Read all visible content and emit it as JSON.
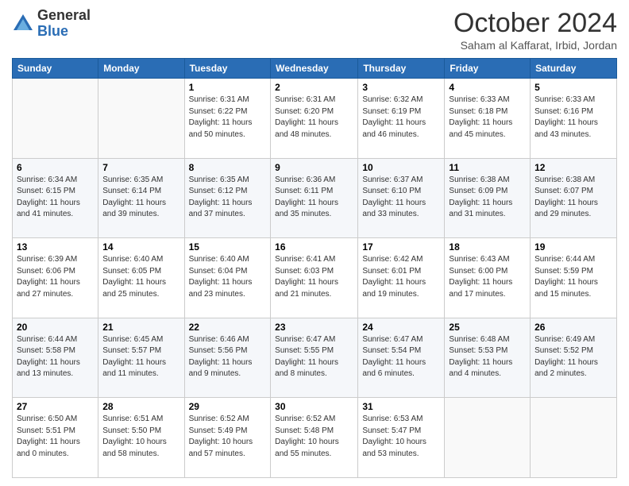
{
  "header": {
    "logo": {
      "general": "General",
      "blue": "Blue"
    },
    "title": "October 2024",
    "subtitle": "Saham al Kaffarat, Irbid, Jordan"
  },
  "calendar": {
    "days_of_week": [
      "Sunday",
      "Monday",
      "Tuesday",
      "Wednesday",
      "Thursday",
      "Friday",
      "Saturday"
    ],
    "weeks": [
      [
        {
          "day": "",
          "sunrise": "",
          "sunset": "",
          "daylight": ""
        },
        {
          "day": "",
          "sunrise": "",
          "sunset": "",
          "daylight": ""
        },
        {
          "day": "1",
          "sunrise": "Sunrise: 6:31 AM",
          "sunset": "Sunset: 6:22 PM",
          "daylight": "Daylight: 11 hours and 50 minutes."
        },
        {
          "day": "2",
          "sunrise": "Sunrise: 6:31 AM",
          "sunset": "Sunset: 6:20 PM",
          "daylight": "Daylight: 11 hours and 48 minutes."
        },
        {
          "day": "3",
          "sunrise": "Sunrise: 6:32 AM",
          "sunset": "Sunset: 6:19 PM",
          "daylight": "Daylight: 11 hours and 46 minutes."
        },
        {
          "day": "4",
          "sunrise": "Sunrise: 6:33 AM",
          "sunset": "Sunset: 6:18 PM",
          "daylight": "Daylight: 11 hours and 45 minutes."
        },
        {
          "day": "5",
          "sunrise": "Sunrise: 6:33 AM",
          "sunset": "Sunset: 6:16 PM",
          "daylight": "Daylight: 11 hours and 43 minutes."
        }
      ],
      [
        {
          "day": "6",
          "sunrise": "Sunrise: 6:34 AM",
          "sunset": "Sunset: 6:15 PM",
          "daylight": "Daylight: 11 hours and 41 minutes."
        },
        {
          "day": "7",
          "sunrise": "Sunrise: 6:35 AM",
          "sunset": "Sunset: 6:14 PM",
          "daylight": "Daylight: 11 hours and 39 minutes."
        },
        {
          "day": "8",
          "sunrise": "Sunrise: 6:35 AM",
          "sunset": "Sunset: 6:12 PM",
          "daylight": "Daylight: 11 hours and 37 minutes."
        },
        {
          "day": "9",
          "sunrise": "Sunrise: 6:36 AM",
          "sunset": "Sunset: 6:11 PM",
          "daylight": "Daylight: 11 hours and 35 minutes."
        },
        {
          "day": "10",
          "sunrise": "Sunrise: 6:37 AM",
          "sunset": "Sunset: 6:10 PM",
          "daylight": "Daylight: 11 hours and 33 minutes."
        },
        {
          "day": "11",
          "sunrise": "Sunrise: 6:38 AM",
          "sunset": "Sunset: 6:09 PM",
          "daylight": "Daylight: 11 hours and 31 minutes."
        },
        {
          "day": "12",
          "sunrise": "Sunrise: 6:38 AM",
          "sunset": "Sunset: 6:07 PM",
          "daylight": "Daylight: 11 hours and 29 minutes."
        }
      ],
      [
        {
          "day": "13",
          "sunrise": "Sunrise: 6:39 AM",
          "sunset": "Sunset: 6:06 PM",
          "daylight": "Daylight: 11 hours and 27 minutes."
        },
        {
          "day": "14",
          "sunrise": "Sunrise: 6:40 AM",
          "sunset": "Sunset: 6:05 PM",
          "daylight": "Daylight: 11 hours and 25 minutes."
        },
        {
          "day": "15",
          "sunrise": "Sunrise: 6:40 AM",
          "sunset": "Sunset: 6:04 PM",
          "daylight": "Daylight: 11 hours and 23 minutes."
        },
        {
          "day": "16",
          "sunrise": "Sunrise: 6:41 AM",
          "sunset": "Sunset: 6:03 PM",
          "daylight": "Daylight: 11 hours and 21 minutes."
        },
        {
          "day": "17",
          "sunrise": "Sunrise: 6:42 AM",
          "sunset": "Sunset: 6:01 PM",
          "daylight": "Daylight: 11 hours and 19 minutes."
        },
        {
          "day": "18",
          "sunrise": "Sunrise: 6:43 AM",
          "sunset": "Sunset: 6:00 PM",
          "daylight": "Daylight: 11 hours and 17 minutes."
        },
        {
          "day": "19",
          "sunrise": "Sunrise: 6:44 AM",
          "sunset": "Sunset: 5:59 PM",
          "daylight": "Daylight: 11 hours and 15 minutes."
        }
      ],
      [
        {
          "day": "20",
          "sunrise": "Sunrise: 6:44 AM",
          "sunset": "Sunset: 5:58 PM",
          "daylight": "Daylight: 11 hours and 13 minutes."
        },
        {
          "day": "21",
          "sunrise": "Sunrise: 6:45 AM",
          "sunset": "Sunset: 5:57 PM",
          "daylight": "Daylight: 11 hours and 11 minutes."
        },
        {
          "day": "22",
          "sunrise": "Sunrise: 6:46 AM",
          "sunset": "Sunset: 5:56 PM",
          "daylight": "Daylight: 11 hours and 9 minutes."
        },
        {
          "day": "23",
          "sunrise": "Sunrise: 6:47 AM",
          "sunset": "Sunset: 5:55 PM",
          "daylight": "Daylight: 11 hours and 8 minutes."
        },
        {
          "day": "24",
          "sunrise": "Sunrise: 6:47 AM",
          "sunset": "Sunset: 5:54 PM",
          "daylight": "Daylight: 11 hours and 6 minutes."
        },
        {
          "day": "25",
          "sunrise": "Sunrise: 6:48 AM",
          "sunset": "Sunset: 5:53 PM",
          "daylight": "Daylight: 11 hours and 4 minutes."
        },
        {
          "day": "26",
          "sunrise": "Sunrise: 6:49 AM",
          "sunset": "Sunset: 5:52 PM",
          "daylight": "Daylight: 11 hours and 2 minutes."
        }
      ],
      [
        {
          "day": "27",
          "sunrise": "Sunrise: 6:50 AM",
          "sunset": "Sunset: 5:51 PM",
          "daylight": "Daylight: 11 hours and 0 minutes."
        },
        {
          "day": "28",
          "sunrise": "Sunrise: 6:51 AM",
          "sunset": "Sunset: 5:50 PM",
          "daylight": "Daylight: 10 hours and 58 minutes."
        },
        {
          "day": "29",
          "sunrise": "Sunrise: 6:52 AM",
          "sunset": "Sunset: 5:49 PM",
          "daylight": "Daylight: 10 hours and 57 minutes."
        },
        {
          "day": "30",
          "sunrise": "Sunrise: 6:52 AM",
          "sunset": "Sunset: 5:48 PM",
          "daylight": "Daylight: 10 hours and 55 minutes."
        },
        {
          "day": "31",
          "sunrise": "Sunrise: 6:53 AM",
          "sunset": "Sunset: 5:47 PM",
          "daylight": "Daylight: 10 hours and 53 minutes."
        },
        {
          "day": "",
          "sunrise": "",
          "sunset": "",
          "daylight": ""
        },
        {
          "day": "",
          "sunrise": "",
          "sunset": "",
          "daylight": ""
        }
      ]
    ]
  }
}
